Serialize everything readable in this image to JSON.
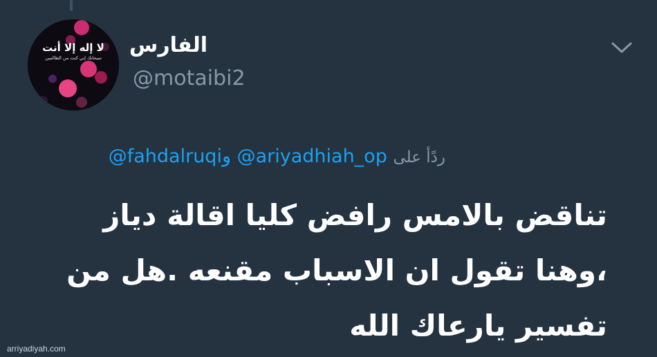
{
  "profile": {
    "display_name": "الفارس",
    "handle": "@motaibi2",
    "avatar_caption_main": "لا إله إلا أنت",
    "avatar_caption_sub": "سبحانك إني كنت من الظالمين"
  },
  "reply": {
    "prefix": "ردًأ على",
    "mention_1": "@ariyadhiah_op",
    "conjunction": "و",
    "mention_2": "@fahdalruqi"
  },
  "tweet": {
    "text": "تناقض بالامس رافض كليا اقالة دياز ،وهنا تقول ان الاسباب مقنعه .هل من تفسير يارعاك الله"
  },
  "watermark": "arriyadiyah.com",
  "colors": {
    "background": "#253341",
    "link": "#1da1f2",
    "secondary_text": "#8899a6"
  },
  "icons": {
    "menu": "chevron-down-icon"
  }
}
